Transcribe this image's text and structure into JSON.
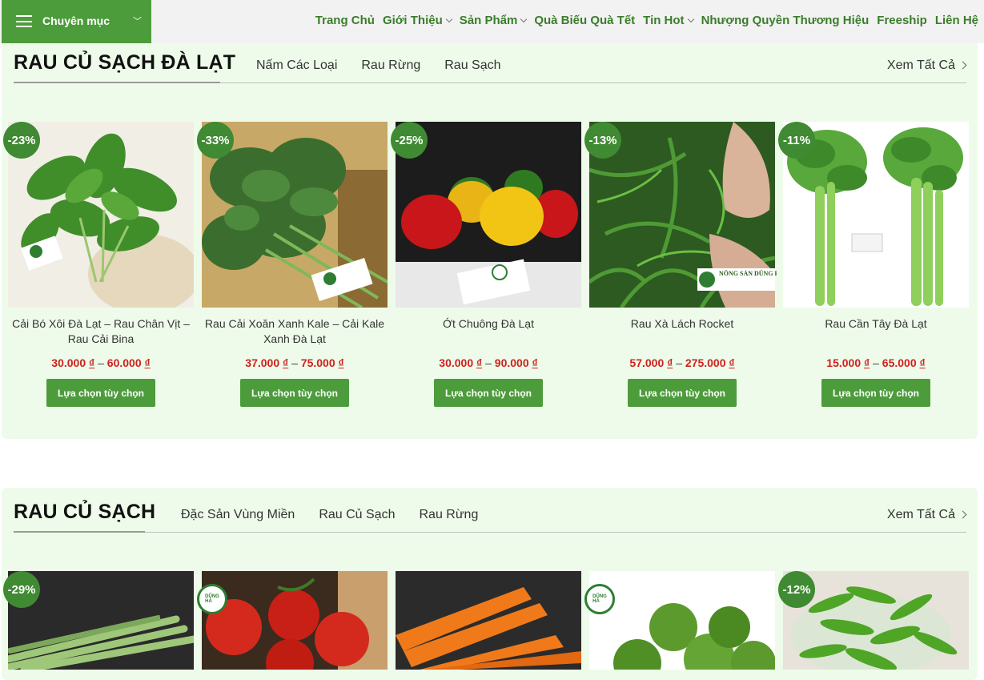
{
  "header": {
    "category_label": "Chuyên mục",
    "nav": [
      {
        "label": "Trang Chủ",
        "dropdown": false
      },
      {
        "label": "Giới Thiệu",
        "dropdown": true
      },
      {
        "label": "Sản Phẩm",
        "dropdown": true
      },
      {
        "label": "Quà Biếu Quà Tết",
        "dropdown": false
      },
      {
        "label": "Tin Hot",
        "dropdown": true
      },
      {
        "label": "Nhượng Quyền Thương Hiệu",
        "dropdown": false
      },
      {
        "label": "Freeship",
        "dropdown": false
      },
      {
        "label": "Liên Hệ",
        "dropdown": false
      }
    ]
  },
  "colors": {
    "brand_green": "#4d9c3c",
    "badge_green": "#3f8a32",
    "price_red": "#d0211c",
    "section_bg": "#eefbea"
  },
  "sections": [
    {
      "title": "RAU CỦ SẠCH ĐÀ LẠT",
      "tabs": [
        "Nấm Các Loại",
        "Rau Rừng",
        "Rau Sạch"
      ],
      "see_all": "Xem Tất Cả",
      "products": [
        {
          "name": "Cải Bó Xôi Đà Lạt – Rau Chân Vịt – Rau Cải Bina",
          "discount": "-23%",
          "price_min": "30.000",
          "price_max": "60.000",
          "currency": "₫",
          "button": "Lựa chọn tùy chọn",
          "image": "spinach"
        },
        {
          "name": "Rau Cải Xoăn Xanh Kale – Cải Kale Xanh Đà Lạt",
          "discount": "-33%",
          "price_min": "37.000",
          "price_max": "75.000",
          "currency": "₫",
          "button": "Lựa chọn tùy chọn",
          "image": "kale"
        },
        {
          "name": "Ớt Chuông Đà Lạt",
          "discount": "-25%",
          "price_min": "30.000",
          "price_max": "90.000",
          "currency": "₫",
          "button": "Lựa chọn tùy chọn",
          "image": "bell-peppers"
        },
        {
          "name": "Rau Xà Lách Rocket",
          "discount": "-13%",
          "price_min": "57.000",
          "price_max": "275.000",
          "currency": "₫",
          "button": "Lựa chọn tùy chọn",
          "image": "rocket-lettuce",
          "image_caption": "NÔNG SẢN DŨNG HÀ"
        },
        {
          "name": "Rau Cần Tây Đà Lạt",
          "discount": "-11%",
          "price_min": "15.000",
          "price_max": "65.000",
          "currency": "₫",
          "button": "Lựa chọn tùy chọn",
          "image": "celery"
        }
      ]
    },
    {
      "title": "RAU CỦ SẠCH",
      "tabs": [
        "Đặc Sản Vùng Miền",
        "Rau Củ Sạch",
        "Rau Rừng"
      ],
      "see_all": "Xem Tất Cả",
      "products": [
        {
          "discount": "-29%",
          "image": "asparagus"
        },
        {
          "discount": "",
          "image": "tomatoes",
          "logo": true
        },
        {
          "discount": "",
          "image": "carrots"
        },
        {
          "discount": "",
          "image": "limes",
          "logo": true
        },
        {
          "discount": "-12%",
          "image": "green-peas"
        }
      ]
    }
  ]
}
